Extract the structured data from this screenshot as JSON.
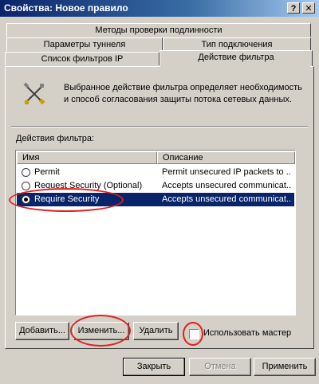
{
  "window": {
    "title": "Свойства: Новое правило",
    "help_glyph": "?",
    "close_glyph": "✕"
  },
  "tabs": [
    {
      "label": "Методы проверки подлинности"
    },
    {
      "label": "Параметры туннеля"
    },
    {
      "label": "Тип подключения"
    },
    {
      "label": "Список фильтров IP"
    },
    {
      "label": "Действие фильтра",
      "active": true
    }
  ],
  "panel": {
    "icon": "tools-icon",
    "description": "Выбранное действие фильтра определяет необходимость и способ согласования защиты потока сетевых данных.",
    "list_label": "Действия фильтра:",
    "columns": {
      "name": "Имя",
      "description": "Описание"
    },
    "rows": [
      {
        "name": "Permit",
        "description": "Permit unsecured IP packets to ...",
        "selected": false
      },
      {
        "name": "Request Security (Optional)",
        "description": "Accepts unsecured communicat...",
        "selected": false
      },
      {
        "name": "Require Security",
        "description": "Accepts unsecured communicat...",
        "selected": true
      }
    ],
    "buttons": {
      "add": "Добавить...",
      "edit": "Изменить...",
      "remove": "Удалить"
    },
    "wizard_checkbox": {
      "label": "Использовать мастер",
      "checked": false
    }
  },
  "footer": {
    "close": "Закрыть",
    "cancel": "Отмена",
    "apply": "Применить"
  },
  "colors": {
    "selection": "#0a246a",
    "annotation": "#e02020",
    "face": "#d4d0c8"
  }
}
